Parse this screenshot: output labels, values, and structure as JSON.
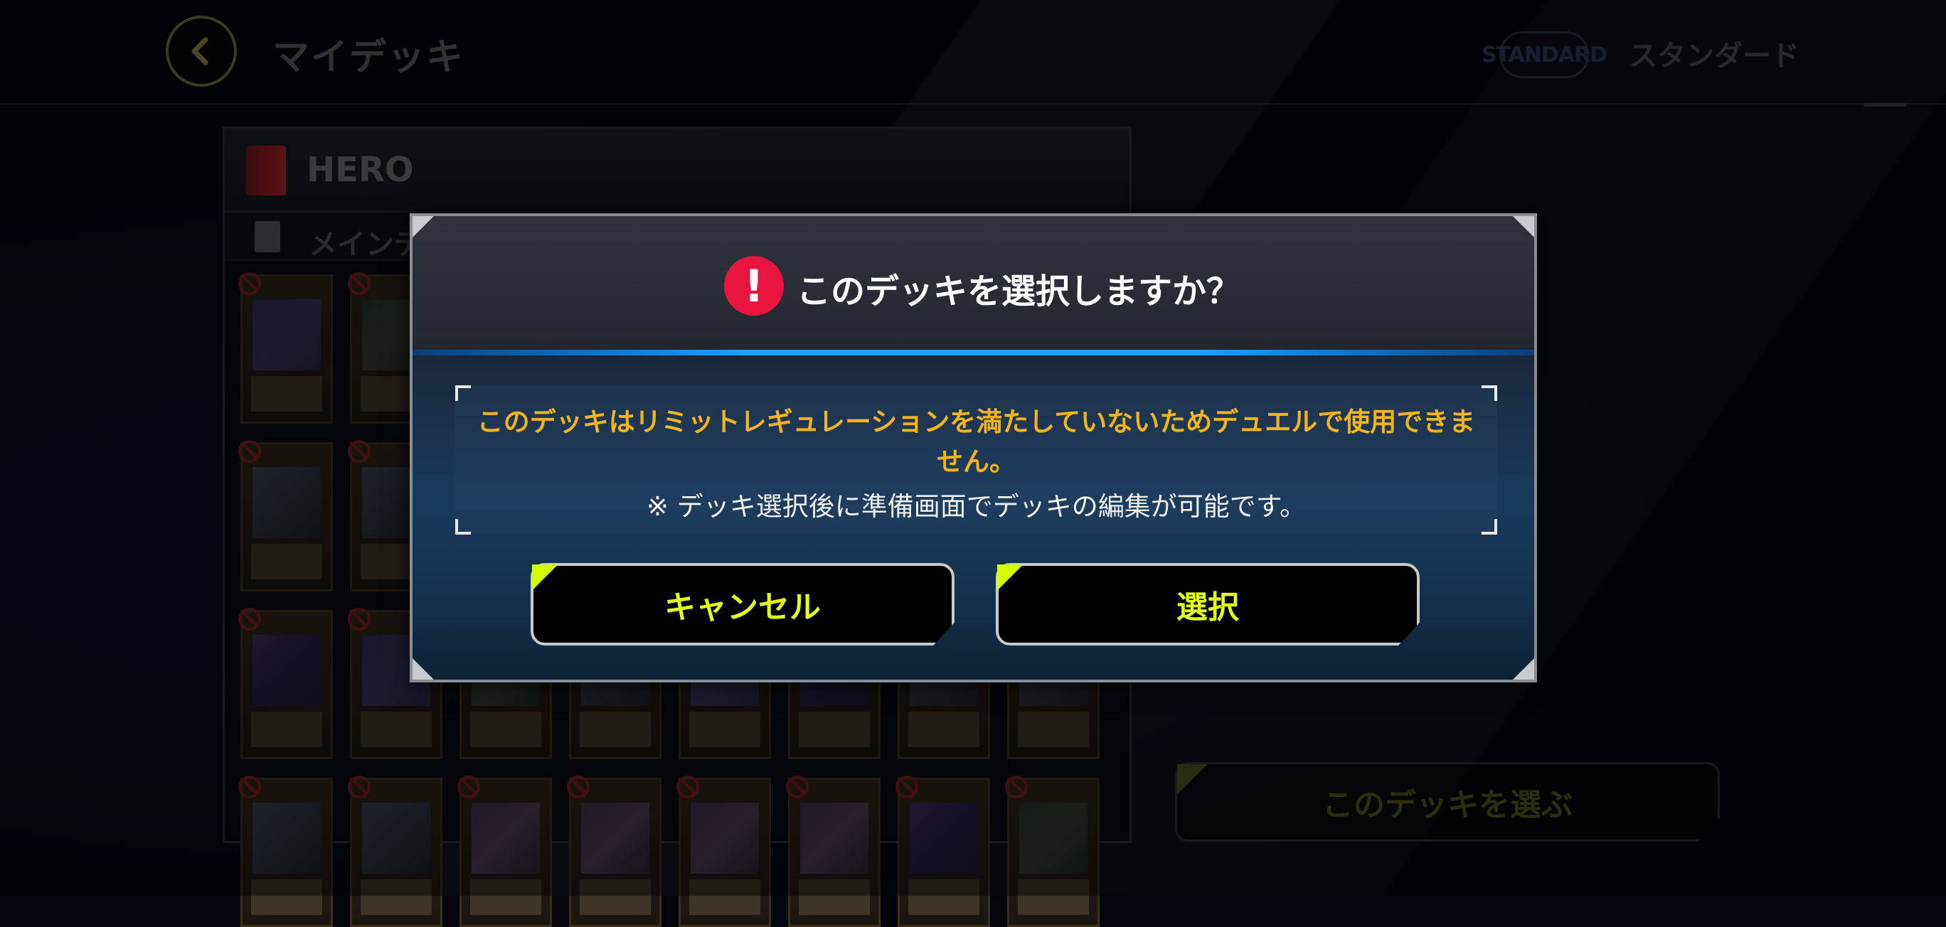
{
  "header": {
    "title": "マイデッキ",
    "format_badge": "STANDARD",
    "format_label": "スタンダード"
  },
  "deck": {
    "name": "HERO",
    "section_label": "メインデ"
  },
  "choose_deck_button": "このデッキを選ぶ",
  "dialog": {
    "title": "このデッキを選択しますか？",
    "warning": "このデッキはリミットレギュレーションを満たしていないためデュエルで使用できません。",
    "note": "※ デッキ選択後に準備画面でデッキの編集が可能です。",
    "cancel_label": "キャンセル",
    "select_label": "選択"
  },
  "icons": {
    "back": "chevron-left-icon",
    "warning": "exclamation-icon",
    "ban": "forbidden-icon"
  },
  "colors": {
    "accent": "#e1ff1a",
    "warning_text": "#f2b321",
    "warning_icon": "#e8163e",
    "divider": "#1ea0ff"
  }
}
